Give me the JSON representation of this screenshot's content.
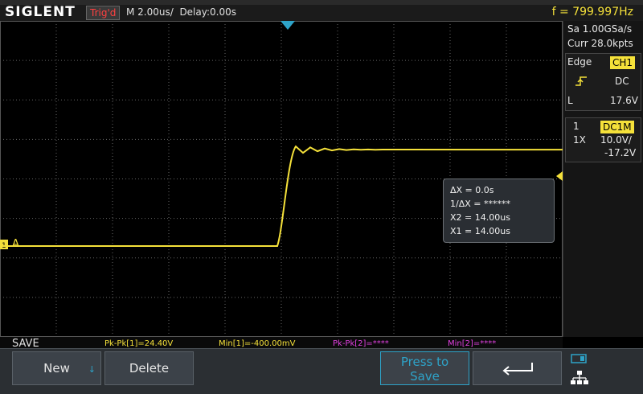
{
  "header": {
    "brand": "SIGLENT",
    "trigger_status": "Trig'd",
    "timebase": "M 2.00us/",
    "delay": "Delay:0.00s",
    "frequency": "f = 799.997Hz"
  },
  "acquisition": {
    "sample_rate": "Sa 1.00GSa/s",
    "memory": "Curr 28.0kpts"
  },
  "trigger_panel": {
    "type": "Edge",
    "source": "CH1",
    "slope_icon": "rising-edge-icon",
    "coupling": "DC",
    "level_label": "L",
    "level": "17.6V"
  },
  "channel_panel": {
    "channel": "1",
    "coupling": "DC1M",
    "probe": "1X",
    "scale": "10.0V/",
    "offset": "-17.2V"
  },
  "cursor_box": {
    "delta_x": "ΔX = 0.0s",
    "inv_delta_x": "1/ΔX = ******",
    "x2": "X2 = 14.00us",
    "x1": "X1 = 14.00us"
  },
  "measurements": [
    {
      "text": "Pk-Pk[1]=24.40V",
      "color": "#f5e13a"
    },
    {
      "text": "Min[1]=-400.00mV",
      "color": "#f5e13a"
    },
    {
      "text": "Pk-Pk[2]=****",
      "color": "#e040e0"
    },
    {
      "text": "Min[2]=****",
      "color": "#e040e0"
    }
  ],
  "menu": {
    "title": "SAVE",
    "new_label": "New",
    "delete_label": "Delete",
    "press_to_save_line1": "Press to",
    "press_to_save_line2": "Save",
    "back_icon": "return-arrow-icon"
  },
  "channel_marker": "A",
  "colors": {
    "trace": "#f5e13a",
    "accent": "#2ea3c8",
    "trigger_marker": "#2ea3c8"
  },
  "waveform": {
    "low_level_v": -0.4,
    "high_level_v": 24.0,
    "step_time_us": 0.0
  }
}
